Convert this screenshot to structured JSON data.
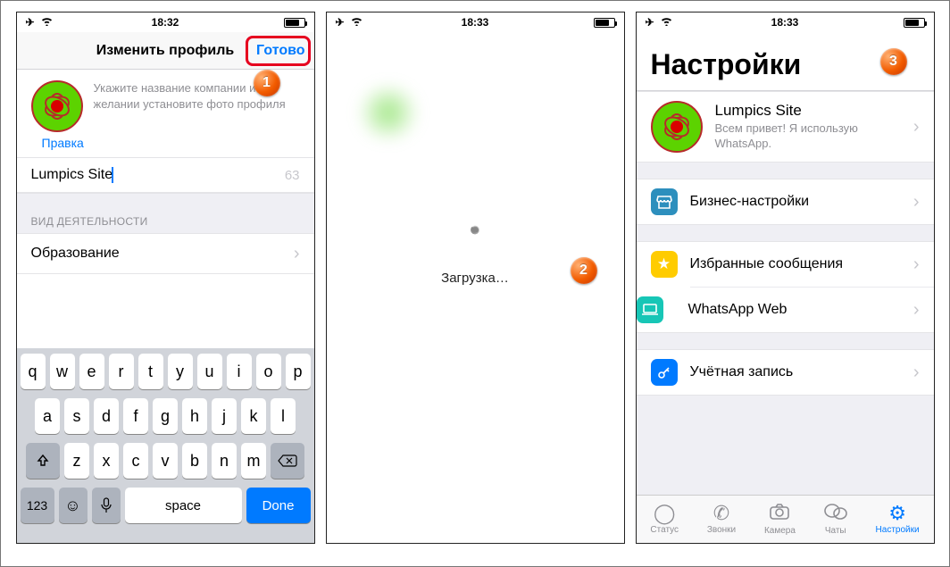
{
  "phone1": {
    "status_time": "18:32",
    "nav_title": "Изменить профиль",
    "done_label": "Готово",
    "hint_text": "Укажите название компании и при желании установите фото профиля",
    "edit_label": "Правка",
    "name_value": "Lumpics Site",
    "name_counter": "63",
    "category_header": "ВИД ДЕЯТЕЛЬНОСТИ",
    "category_value": "Образование",
    "marker": "1",
    "keyboard": {
      "row1": [
        "q",
        "w",
        "e",
        "r",
        "t",
        "y",
        "u",
        "i",
        "o",
        "p"
      ],
      "row2": [
        "a",
        "s",
        "d",
        "f",
        "g",
        "h",
        "j",
        "k",
        "l"
      ],
      "row3": [
        "z",
        "x",
        "c",
        "v",
        "b",
        "n",
        "m"
      ],
      "num_label": "123",
      "space_label": "space",
      "done_label": "Done"
    }
  },
  "phone2": {
    "status_time": "18:33",
    "loading_text": "Загрузка…",
    "marker": "2"
  },
  "phone3": {
    "status_time": "18:33",
    "title": "Настройки",
    "marker": "3",
    "profile": {
      "name": "Lumpics Site",
      "status": "Всем привет! Я использую WhatsApp."
    },
    "rows": {
      "biz": "Бизнес-настройки",
      "starred": "Избранные сообщения",
      "web": "WhatsApp Web",
      "account": "Учётная запись"
    },
    "tabs": {
      "status": "Статус",
      "calls": "Звонки",
      "camera": "Камера",
      "chats": "Чаты",
      "settings": "Настройки"
    }
  }
}
